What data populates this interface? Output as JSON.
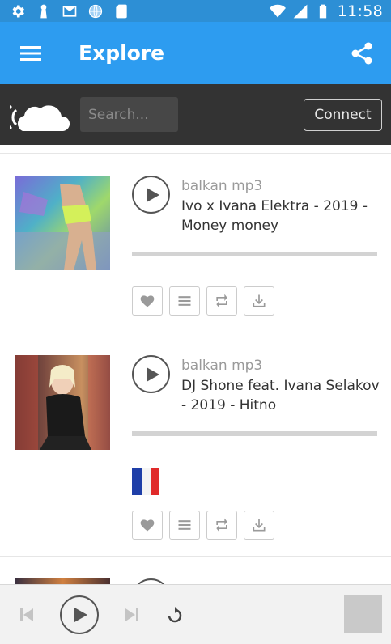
{
  "status_bar": {
    "time": "11:58",
    "left_icons": [
      "settings-icon",
      "keyhole-icon",
      "mail-icon",
      "globe-icon",
      "sd-card-icon"
    ],
    "right_icons": [
      "wifi-icon",
      "cell-signal-icon",
      "battery-icon"
    ]
  },
  "app_bar": {
    "title": "Explore",
    "background": "#2d9cf0"
  },
  "header": {
    "search_placeholder": "Search...",
    "connect_label": "Connect",
    "background": "#333333"
  },
  "tracks": [
    {
      "uploader": "balkan mp3",
      "title": "Ivo x Ivana Elektra - 2019 - Money money",
      "has_flag": false
    },
    {
      "uploader": "balkan mp3",
      "title": "DJ Shone feat. Ivana Selakov - 2019 - Hitno",
      "has_flag": true
    }
  ],
  "actions": [
    "heart-icon",
    "playlist-icon",
    "repost-icon",
    "download-icon"
  ],
  "player": {
    "controls": [
      "previous-icon",
      "play-icon",
      "next-icon",
      "repeat-icon"
    ]
  }
}
